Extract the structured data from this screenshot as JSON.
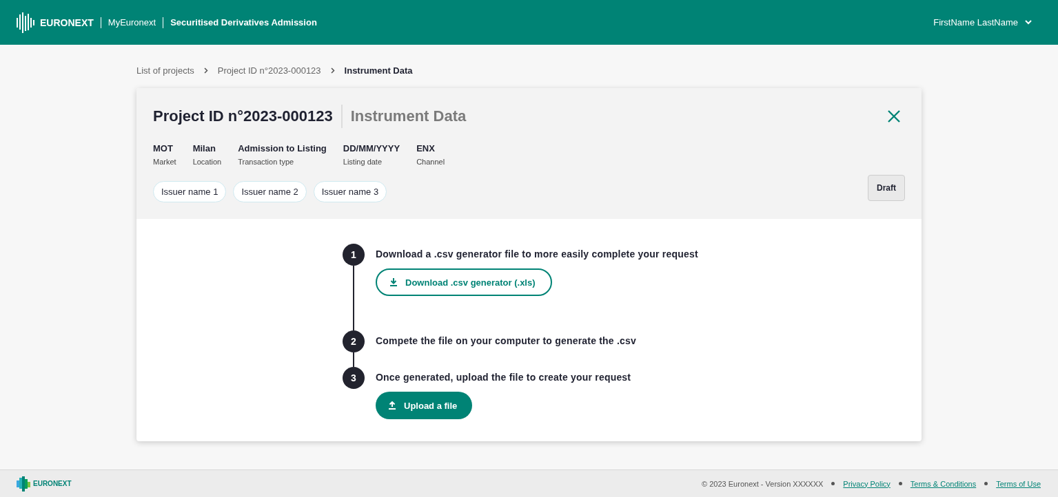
{
  "header": {
    "brand": "EURONEXT",
    "portal": "MyEuronext",
    "app": "Securitised Derivatives Admission",
    "user": "FirstName LastName"
  },
  "breadcrumb": [
    {
      "label": "List of projects",
      "current": false
    },
    {
      "label": "Project ID n°2023-000123",
      "current": false
    },
    {
      "label": "Instrument Data",
      "current": true
    }
  ],
  "project": {
    "title": "Project ID n°2023-000123",
    "subtitle": "Instrument Data",
    "fields": [
      {
        "value": "MOT",
        "label": "Market"
      },
      {
        "value": "Milan",
        "label": "Location"
      },
      {
        "value": "Admission to Listing",
        "label": "Transaction type"
      },
      {
        "value": "DD/MM/YYYY",
        "label": "Listing date"
      },
      {
        "value": "ENX",
        "label": "Channel"
      }
    ],
    "issuers": [
      "Issuer name 1",
      "Issuer name 2",
      "Issuer name 3"
    ],
    "status": "Draft"
  },
  "steps": [
    {
      "number": "1",
      "text": "Download a .csv generator file to more easily complete your request",
      "button": {
        "kind": "outline",
        "label": "Download .csv generator (.xls)"
      }
    },
    {
      "number": "2",
      "text": "Compete the file on your computer to generate the .csv"
    },
    {
      "number": "3",
      "text": "Once generated, upload the file to create your request",
      "button": {
        "kind": "filled",
        "label": "Upload a file"
      }
    }
  ],
  "footer": {
    "brand": "EURONEXT",
    "copyright": "© 2023 Euronext - Version XXXXXX",
    "links": [
      "Privacy Policy",
      "Terms & Conditions",
      "Terms of Use"
    ]
  }
}
